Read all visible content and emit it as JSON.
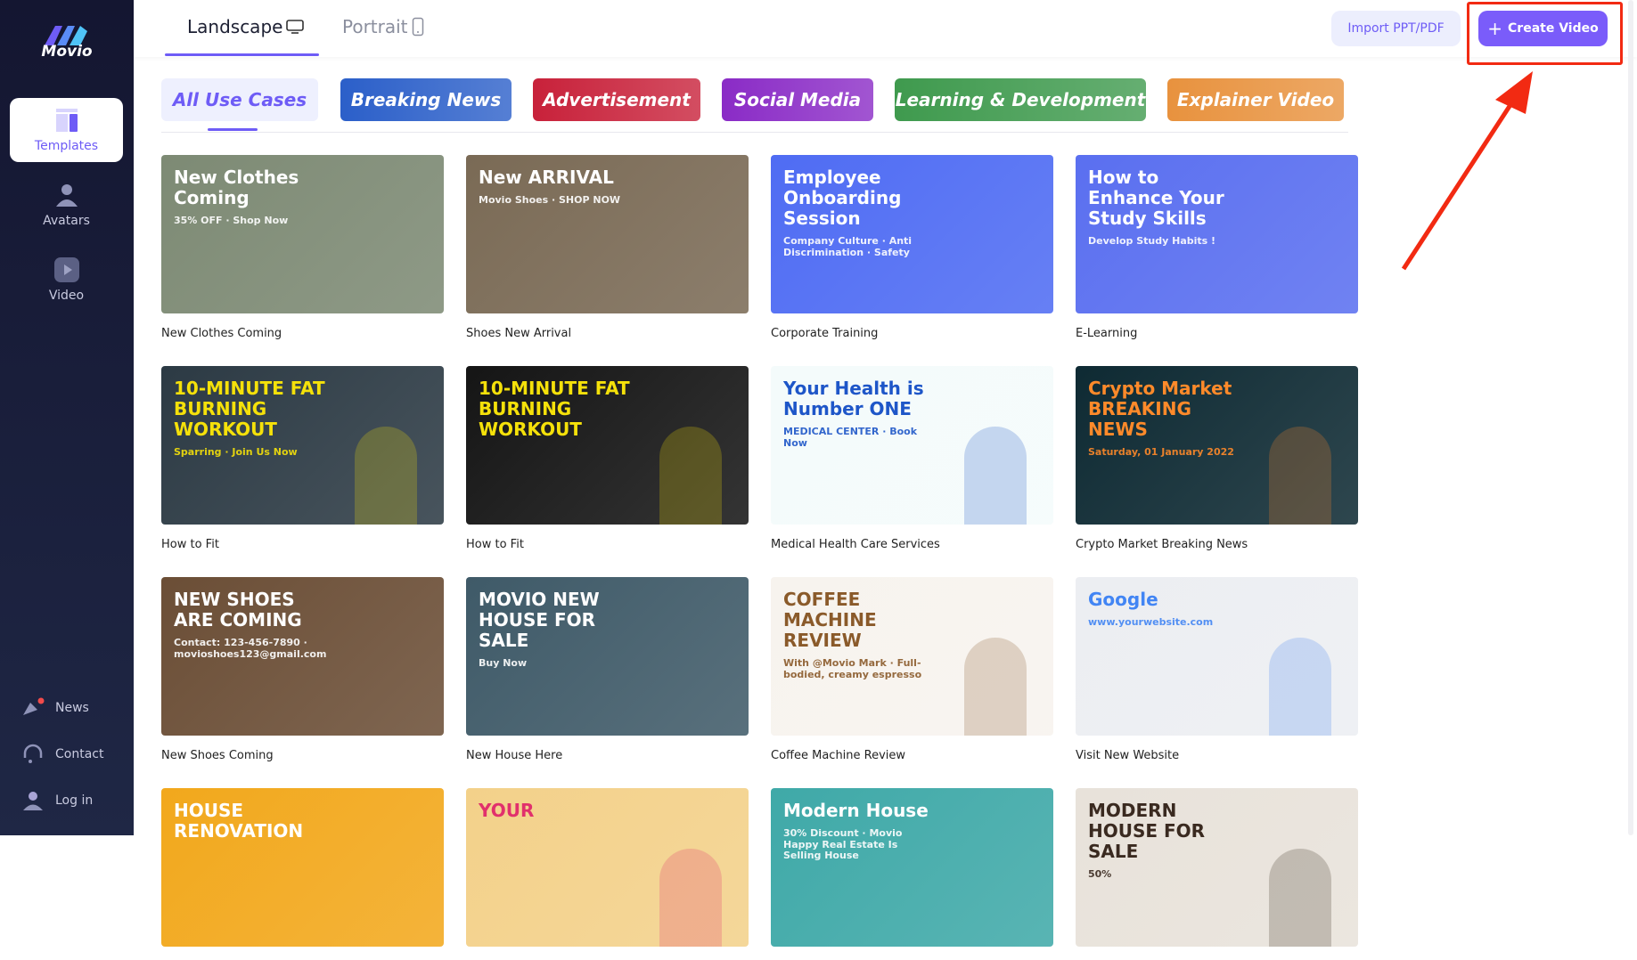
{
  "brand": {
    "name": "Movio",
    "accent": "#6e5cf6"
  },
  "sidebar": {
    "items": [
      {
        "label": "Templates",
        "icon": "templates-icon",
        "active": true
      },
      {
        "label": "Avatars",
        "icon": "avatar-icon"
      },
      {
        "label": "Video",
        "icon": "video-play-icon"
      }
    ],
    "bottom": [
      {
        "label": "News",
        "icon": "megaphone-icon",
        "badge": true
      },
      {
        "label": "Contact",
        "icon": "headset-icon"
      },
      {
        "label": "Log in",
        "icon": "user-icon"
      }
    ]
  },
  "header": {
    "tabs": [
      {
        "label": "Landscape",
        "icon": "monitor-icon",
        "active": true
      },
      {
        "label": "Portrait",
        "icon": "phone-icon"
      }
    ],
    "import_label": "Import PPT/PDF",
    "create_label": "Create Video"
  },
  "categories": [
    {
      "label": "All Use Cases",
      "active": true,
      "color": "#eef0fe"
    },
    {
      "label": "Breaking News",
      "color": "#2b5fc9"
    },
    {
      "label": "Advertisement",
      "color": "#c8213a"
    },
    {
      "label": "Social Media",
      "color": "#8a2bc6"
    },
    {
      "label": "Learning & Development",
      "color": "#3f9a4e"
    },
    {
      "label": "Explainer Video",
      "color": "#e8923e"
    }
  ],
  "templates": [
    {
      "label": "New Clothes Coming",
      "headline": "New Clothes Coming",
      "sub": "35% OFF · Shop Now",
      "bg": "#7d8a74",
      "fg": "#fff"
    },
    {
      "label": "Shoes New Arrival",
      "headline": "New ARRIVAL",
      "sub": "Movio Shoes · SHOP NOW",
      "bg": "#7a6a55",
      "fg": "#fff"
    },
    {
      "label": "Corporate Training",
      "headline": "Employee Onboarding Session",
      "sub": "Company Culture · Anti Discrimination · Safety",
      "bg": "#4f6cf3",
      "fg": "#fff"
    },
    {
      "label": "E-Learning",
      "headline": "How to Enhance Your Study Skills",
      "sub": "Develop Study Habits !",
      "bg": "#5a6ff0",
      "fg": "#fff"
    },
    {
      "label": "How to Fit",
      "headline": "10-MINUTE FAT BURNING WORKOUT",
      "sub": "Sparring · Join Us Now",
      "bg": "#2c3a44",
      "fg": "#f5e10a"
    },
    {
      "label": "How to Fit",
      "headline": "10-MINUTE FAT BURNING WORKOUT",
      "sub": "",
      "bg": "#151515",
      "fg": "#f5e10a"
    },
    {
      "label": "Medical Health Care Services",
      "headline": "Your Health is Number ONE",
      "sub": "MEDICAL CENTER · Book Now",
      "bg": "#f4fbfb",
      "fg": "#1e56c8"
    },
    {
      "label": "Crypto Market Breaking News",
      "headline": "Crypto Market BREAKING NEWS",
      "sub": "Saturday, 01 January 2022",
      "bg": "#0e2a33",
      "fg": "#ff8a2a"
    },
    {
      "label": "New Shoes Coming",
      "headline": "NEW SHOES ARE COMING",
      "sub": "Contact: 123-456-7890 · movioshoes123@gmail.com",
      "bg": "#6b4e36",
      "fg": "#fff"
    },
    {
      "label": "New House Here",
      "headline": "MOVIO NEW HOUSE FOR SALE",
      "sub": "Buy Now",
      "bg": "#3f5a68",
      "fg": "#fff"
    },
    {
      "label": "Coffee Machine Review",
      "headline": "COFFEE MACHINE REVIEW",
      "sub": "With @Movio Mark · Full-bodied, creamy espresso",
      "bg": "#f7f3ee",
      "fg": "#8a5a2a"
    },
    {
      "label": "Visit New Website",
      "headline": "Google",
      "sub": "www.yourwebsite.com",
      "bg": "#eceef2",
      "fg": "#4285f4"
    },
    {
      "label": "",
      "headline": "HOUSE RENOVATION",
      "sub": "",
      "bg": "#f2a81c",
      "fg": "#fff"
    },
    {
      "label": "",
      "headline": "YOUR",
      "sub": "",
      "bg": "#f3d18a",
      "fg": "#e1306c"
    },
    {
      "label": "",
      "headline": "Modern House",
      "sub": "30% Discount · Movio Happy Real Estate Is Selling House",
      "bg": "#3fa9a8",
      "fg": "#fff"
    },
    {
      "label": "",
      "headline": "MODERN HOUSE FOR SALE",
      "sub": "50%",
      "bg": "#e8e2da",
      "fg": "#3a2a20"
    }
  ],
  "annotation": {
    "color": "#f22a12"
  }
}
